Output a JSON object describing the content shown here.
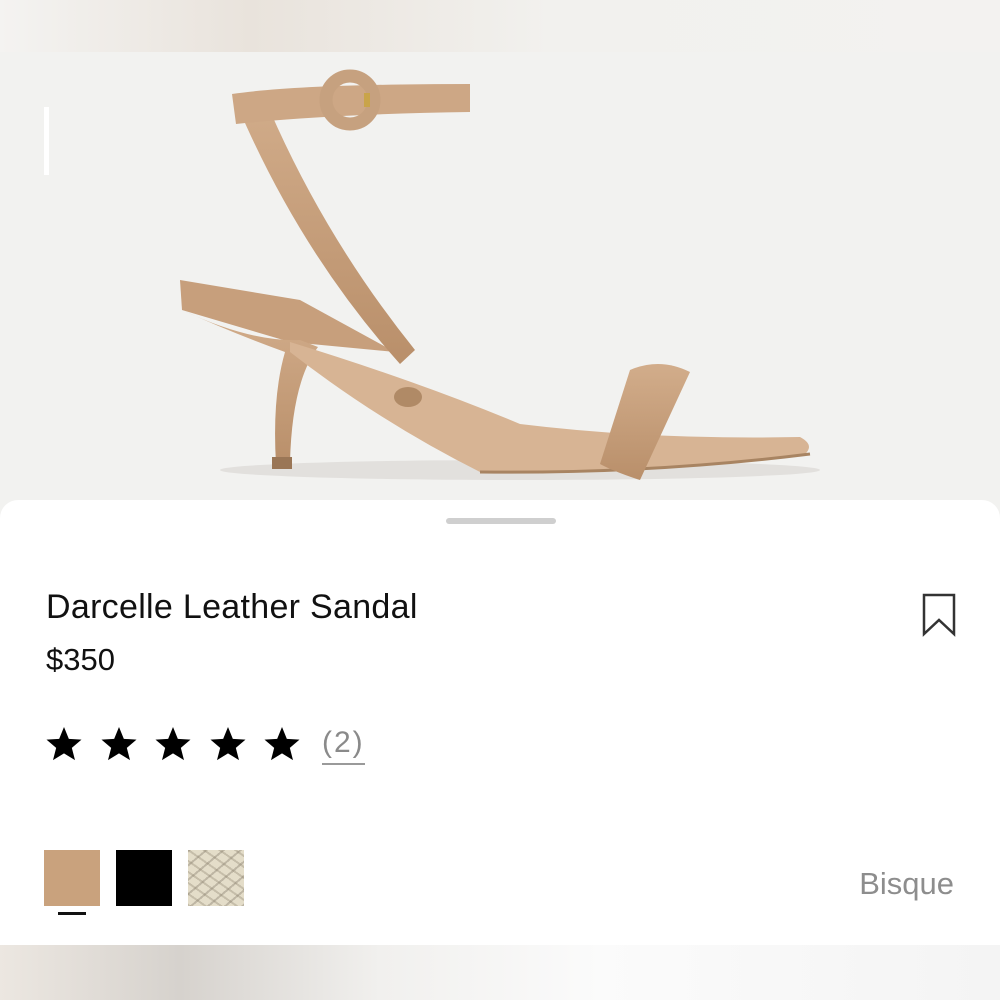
{
  "product": {
    "name": "Darcelle Leather Sandal",
    "price": "$350",
    "rating": 5,
    "rating_max": 5,
    "review_count": "(2)"
  },
  "icons": {
    "bookmark": "bookmark-icon",
    "star": "star-icon"
  },
  "swatches": [
    {
      "name": "Bisque",
      "color": "#c9a27d",
      "selected": true
    },
    {
      "name": "Black",
      "color": "#000000",
      "selected": false
    },
    {
      "name": "Snake print",
      "color": "#e4ddc9",
      "selected": false
    }
  ],
  "selected_color_label": "Bisque",
  "colors": {
    "sandal": "#caa482",
    "sandal_shadow": "#b08a66",
    "buckle": "#c9a44a"
  }
}
